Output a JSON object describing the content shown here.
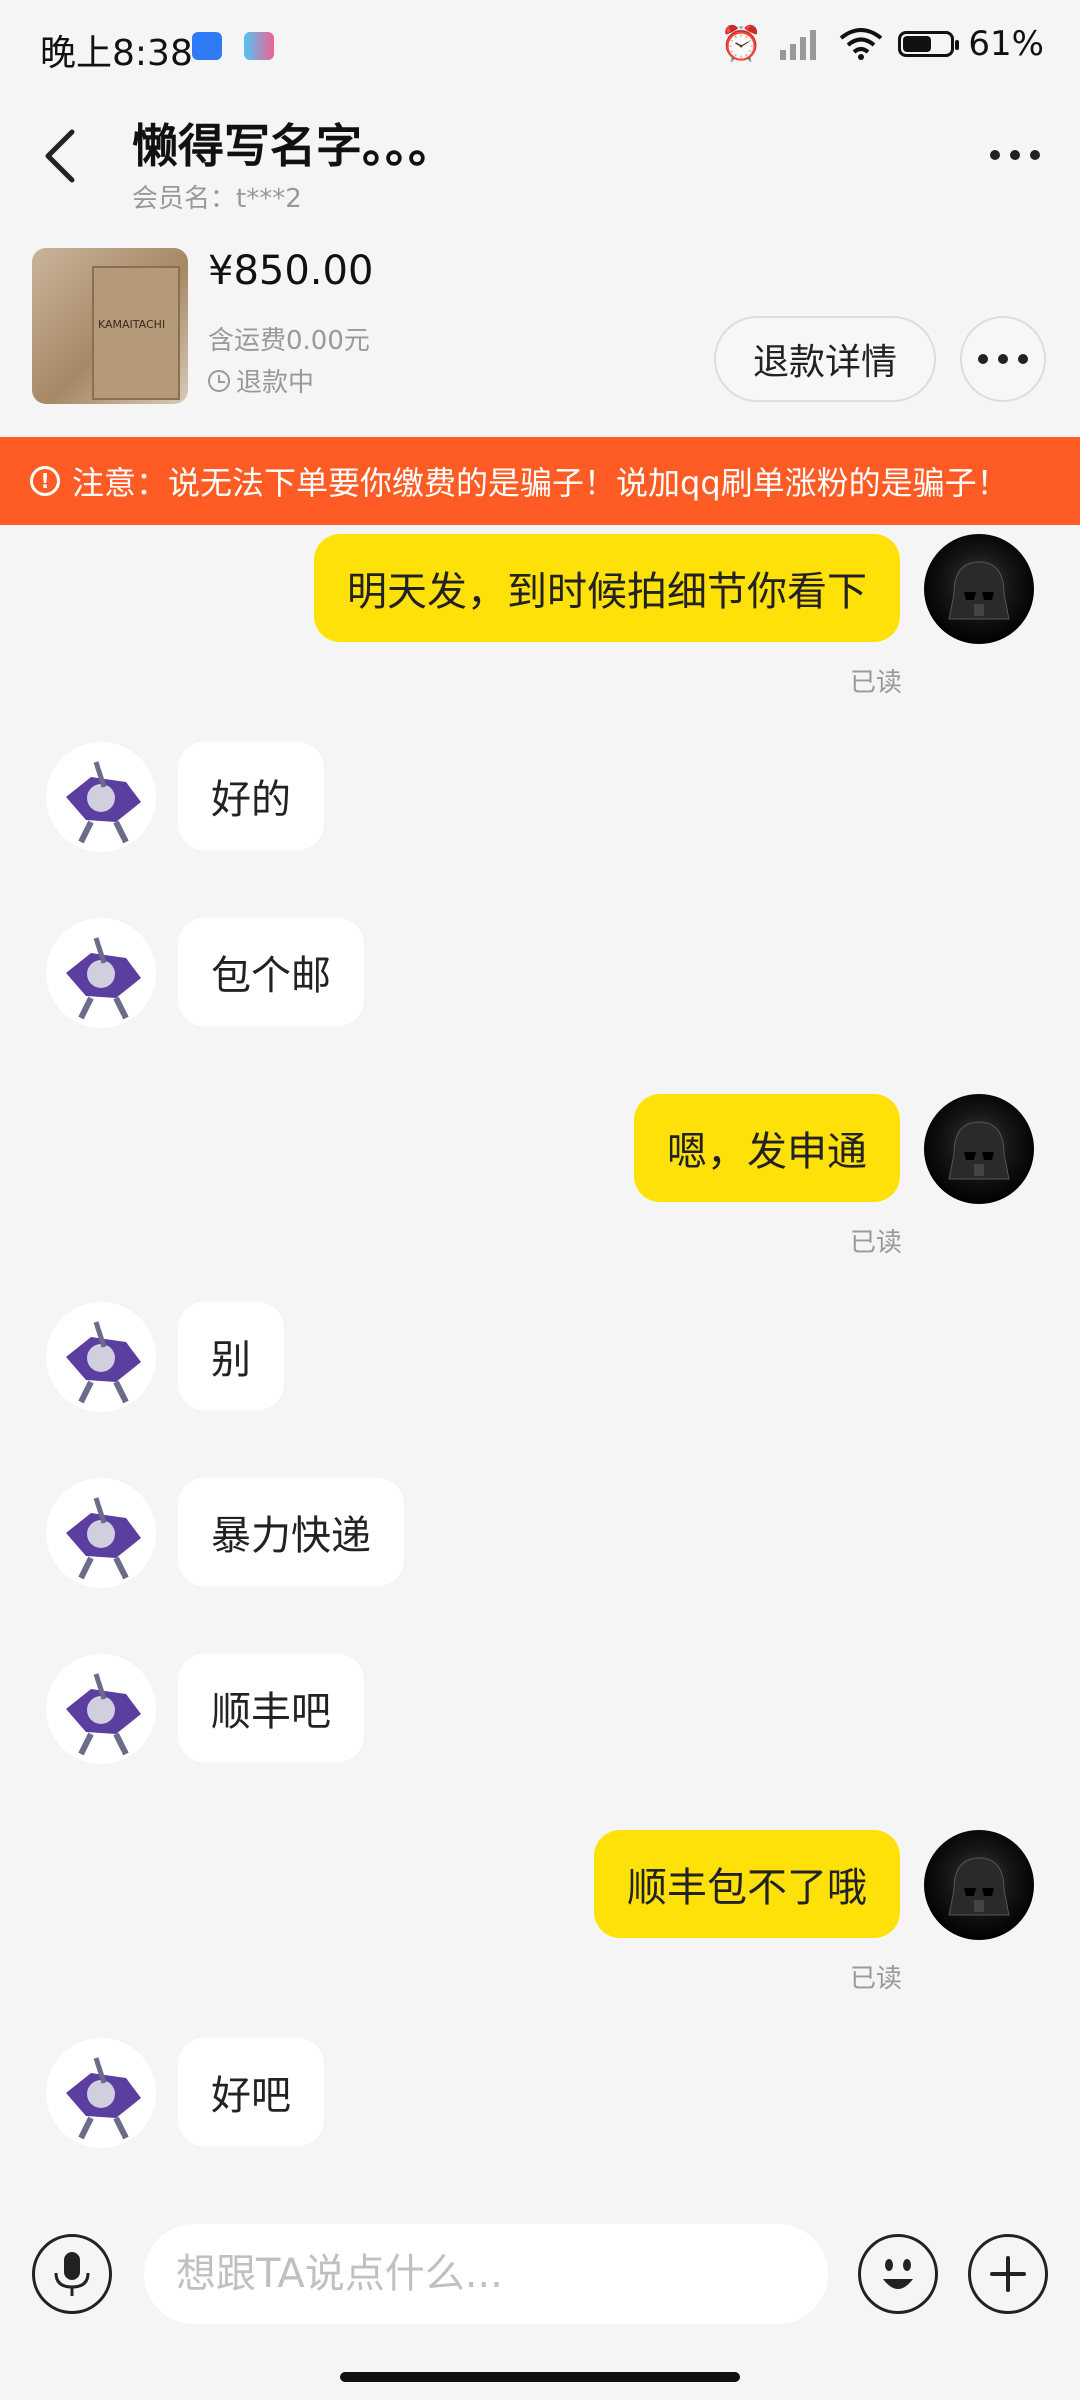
{
  "status_bar": {
    "time": "晚上8:38",
    "battery_text": "61%",
    "battery_level": 0.61,
    "icons": [
      "app-shield-icon",
      "game-icon",
      "alarm-icon",
      "signal-icon",
      "wifi-icon",
      "battery-icon"
    ]
  },
  "header": {
    "title": "懒得写名字。。。",
    "member": "会员名：t***2"
  },
  "product": {
    "price": "¥850.00",
    "shipping": "含运费0.00元",
    "status": "退款中",
    "refund_button": "退款详情",
    "thumb_text": "KAMAITACHI"
  },
  "warning": {
    "text": "注意：说无法下单要你缴费的是骗子！说加qq刷单涨粉的是骗子！"
  },
  "messages": [
    {
      "side": "mine",
      "text": "明天发，到时候拍细节你看下",
      "read": "已读"
    },
    {
      "side": "theirs",
      "text": "好的"
    },
    {
      "side": "theirs",
      "text": "包个邮"
    },
    {
      "side": "mine",
      "text": "嗯，发申通",
      "read": "已读"
    },
    {
      "side": "theirs",
      "text": "别"
    },
    {
      "side": "theirs",
      "text": "暴力快递"
    },
    {
      "side": "theirs",
      "text": "顺丰吧"
    },
    {
      "side": "mine",
      "text": "顺丰包不了哦",
      "read": "已读"
    },
    {
      "side": "theirs",
      "text": "好吧"
    }
  ],
  "input": {
    "placeholder": "想跟TA说点什么..."
  },
  "colors": {
    "accent": "#ffe10a",
    "warning": "#ff5b24",
    "background": "#f5f5f5"
  }
}
